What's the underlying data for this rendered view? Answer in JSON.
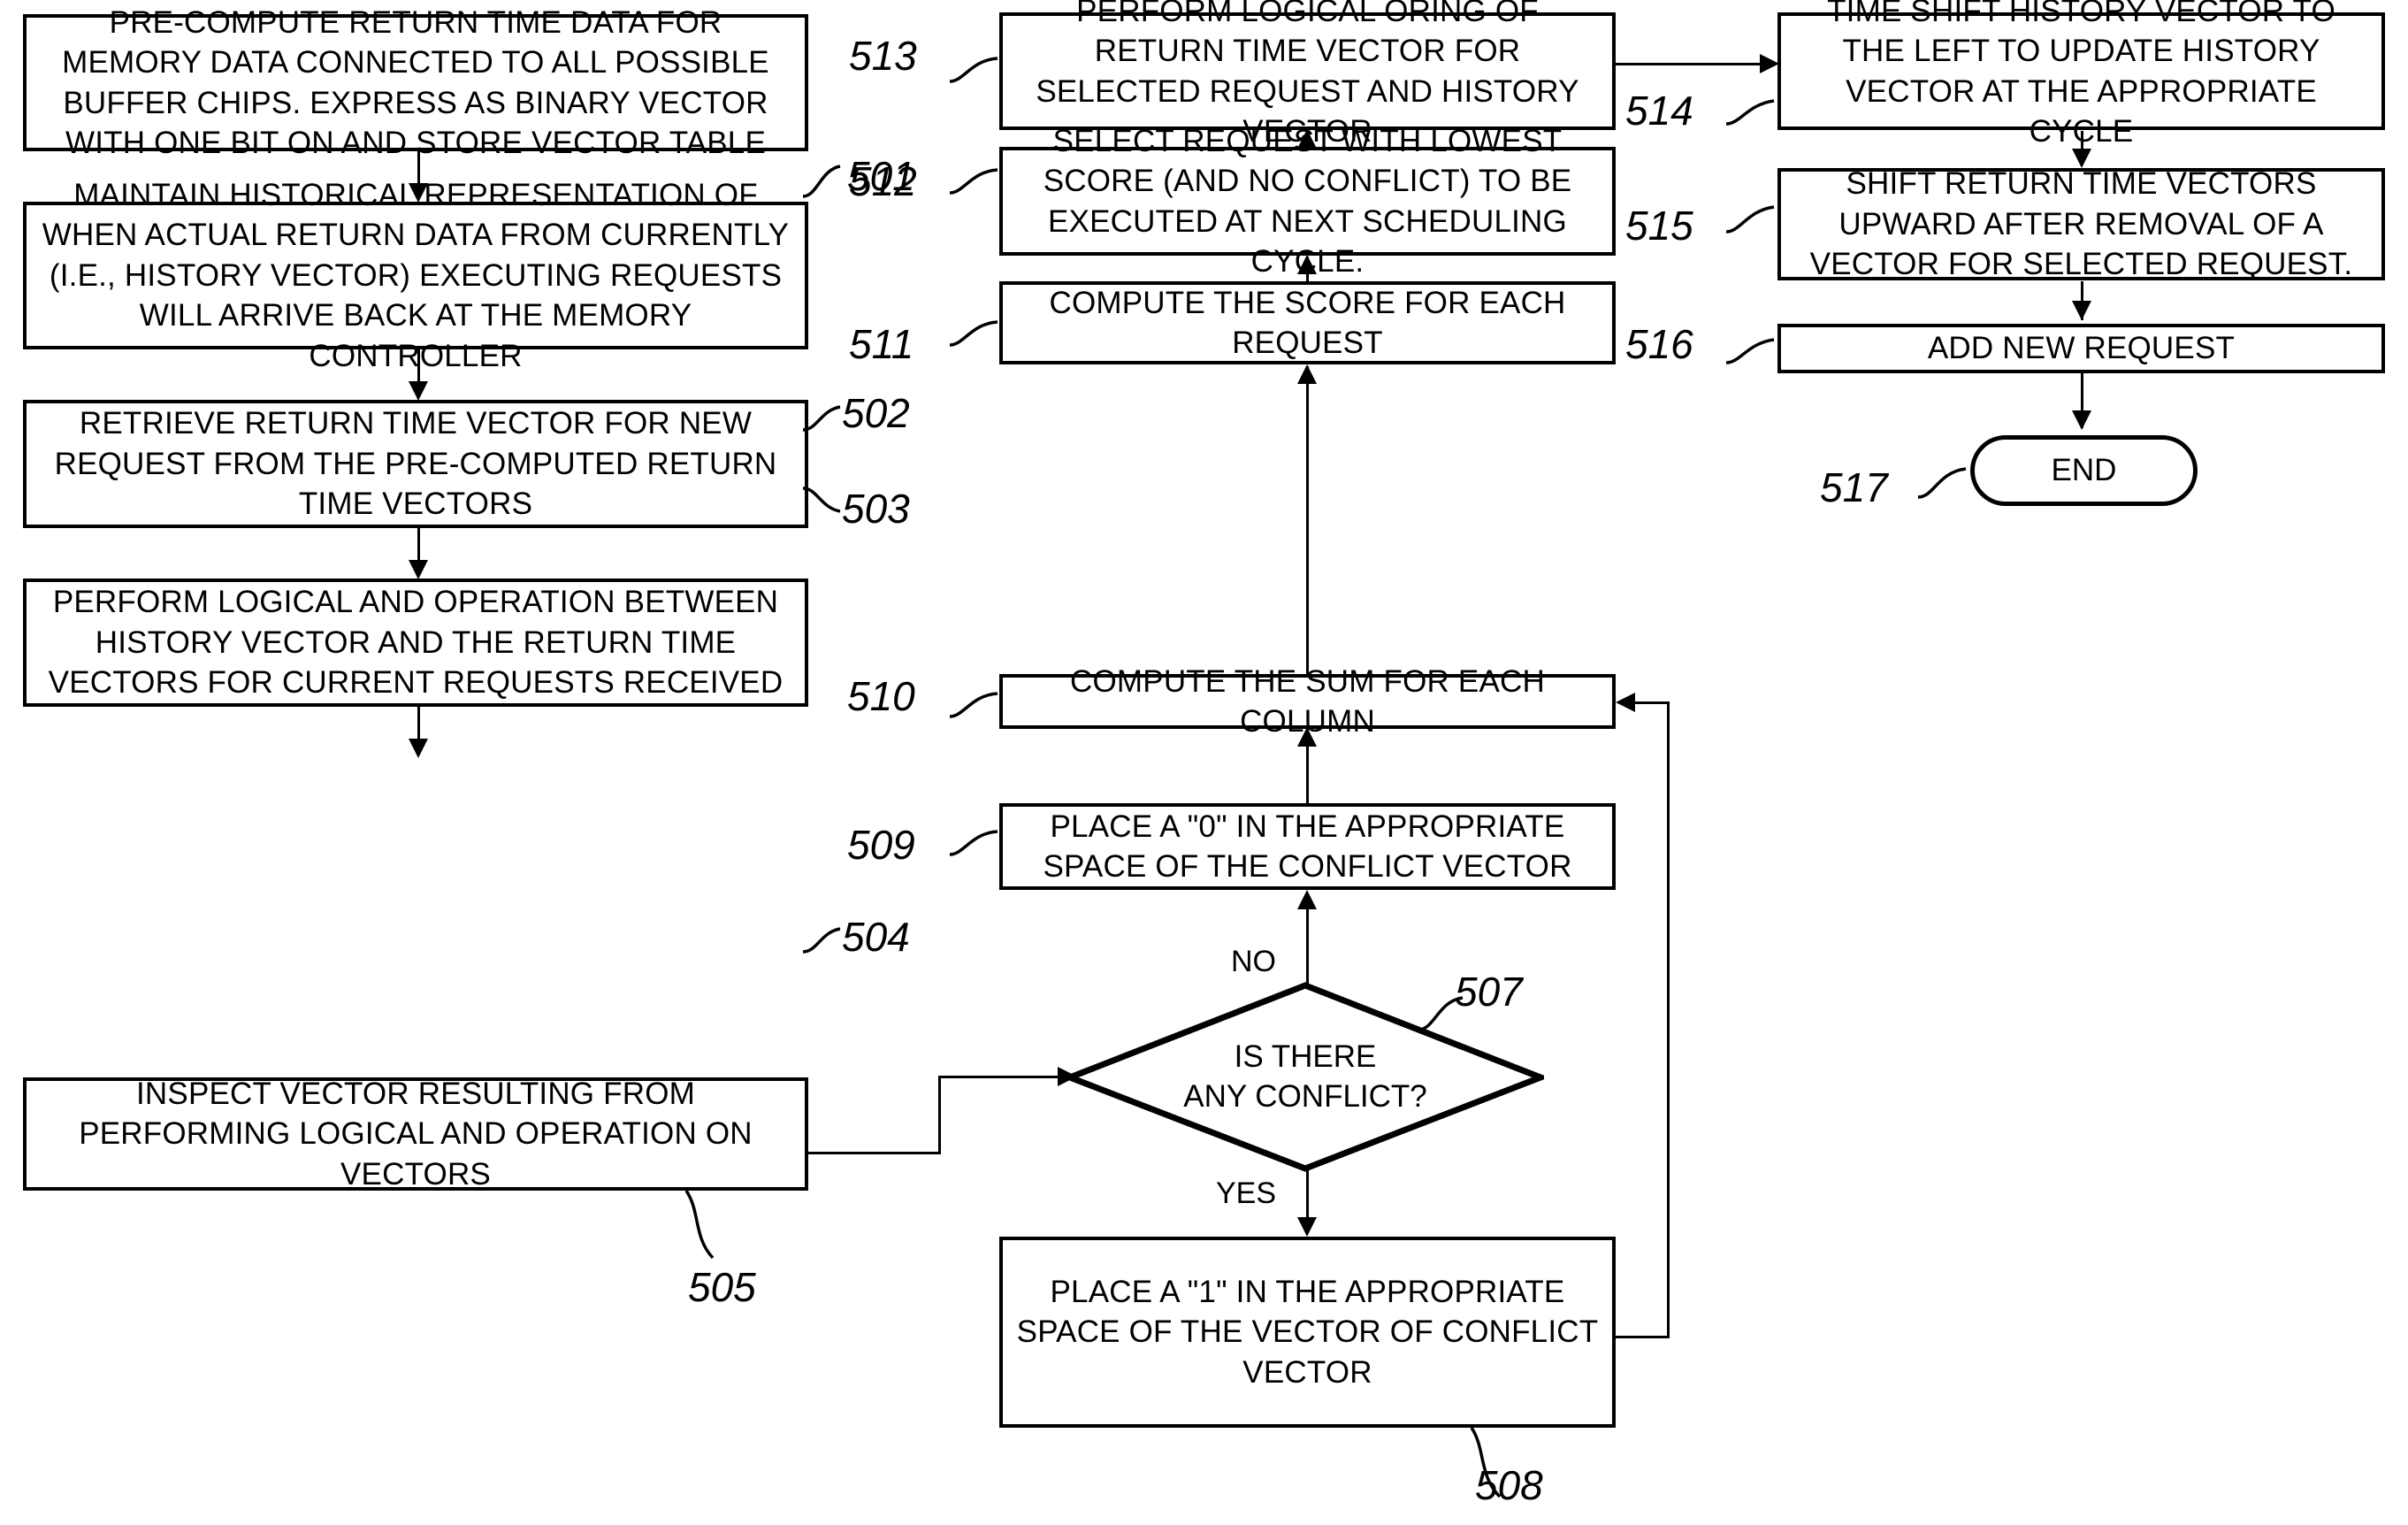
{
  "figure": {
    "kind": "patent-flowchart",
    "background": "#ffffff",
    "ink": "#000000"
  },
  "nodes": [
    {
      "ref": "501",
      "shape": "process",
      "text": "PRE-COMPUTE RETURN TIME DATA FOR MEMORY DATA CONNECTED TO ALL POSSIBLE BUFFER CHIPS. EXPRESS AS BINARY VECTOR WITH ONE BIT ON AND STORE VECTOR TABLE"
    },
    {
      "ref": "502",
      "shape": "process",
      "text": "MAINTAIN HISTORICAL REPRESENTATION OF WHEN ACTUAL RETURN DATA FROM CURRENTLY (I.E., HISTORY VECTOR) EXECUTING REQUESTS WILL ARRIVE BACK AT THE MEMORY CONTROLLER"
    },
    {
      "ref": "503",
      "shape": "process",
      "text": "RETRIEVE RETURN TIME VECTOR FOR NEW REQUEST FROM THE PRE-COMPUTED RETURN TIME VECTORS"
    },
    {
      "ref": "504",
      "shape": "process",
      "text": "PERFORM LOGICAL AND OPERATION BETWEEN HISTORY VECTOR AND THE RETURN TIME VECTORS FOR CURRENT REQUESTS RECEIVED"
    },
    {
      "ref": "505",
      "shape": "process",
      "text": "INSPECT VECTOR RESULTING FROM PERFORMING LOGICAL AND OPERATION ON VECTORS"
    },
    {
      "ref": "507",
      "shape": "decision",
      "text_line1": "IS THERE",
      "text_line2": "ANY CONFLICT?"
    },
    {
      "ref": "508",
      "shape": "process",
      "text": "PLACE A \"1\" IN THE APPROPRIATE SPACE OF THE VECTOR OF CONFLICT VECTOR"
    },
    {
      "ref": "509",
      "shape": "process",
      "text": "PLACE A \"0\" IN THE APPROPRIATE SPACE OF THE CONFLICT VECTOR"
    },
    {
      "ref": "510",
      "shape": "process",
      "text": "COMPUTE THE SUM FOR EACH COLUMN"
    },
    {
      "ref": "511",
      "shape": "process",
      "text": "COMPUTE THE SCORE FOR EACH REQUEST"
    },
    {
      "ref": "512",
      "shape": "process",
      "text": "SELECT REQUEST WITH LOWEST SCORE (AND NO CONFLICT) TO BE EXECUTED AT NEXT SCHEDULING CYCLE."
    },
    {
      "ref": "513",
      "shape": "process",
      "text": "PERFORM LOGICAL ORING OF RETURN TIME VECTOR FOR SELECTED REQUEST AND HISTORY VECTOR"
    },
    {
      "ref": "514",
      "shape": "process",
      "text": "TIME SHIFT HISTORY VECTOR TO THE LEFT TO UPDATE HISTORY VECTOR AT THE APPROPRIATE CYCLE"
    },
    {
      "ref": "515",
      "shape": "process",
      "text": "SHIFT RETURN TIME VECTORS UPWARD AFTER REMOVAL OF A VECTOR FOR SELECTED REQUEST."
    },
    {
      "ref": "516",
      "shape": "process",
      "text": "ADD NEW REQUEST"
    },
    {
      "ref": "517",
      "shape": "terminal",
      "text": "END"
    }
  ],
  "branch_labels": {
    "no": "NO",
    "yes": "YES"
  },
  "refs": {
    "n501": "501",
    "n502": "502",
    "n503": "503",
    "n504": "504",
    "n505": "505",
    "n507": "507",
    "n508": "508",
    "n509": "509",
    "n510": "510",
    "n511": "511",
    "n512": "512",
    "n513": "513",
    "n514": "514",
    "n515": "515",
    "n516": "516",
    "n517": "517"
  },
  "node_text": {
    "b501": "PRE-COMPUTE RETURN TIME DATA FOR MEMORY DATA CONNECTED TO ALL POSSIBLE BUFFER CHIPS. EXPRESS AS BINARY VECTOR WITH ONE BIT ON AND STORE VECTOR TABLE",
    "b502": "MAINTAIN HISTORICAL REPRESENTATION OF WHEN ACTUAL RETURN DATA FROM CURRENTLY (I.E., HISTORY VECTOR) EXECUTING REQUESTS WILL ARRIVE BACK AT THE MEMORY CONTROLLER",
    "b503": "RETRIEVE RETURN TIME VECTOR FOR NEW REQUEST FROM THE PRE-COMPUTED RETURN TIME VECTORS",
    "b504": "PERFORM LOGICAL AND OPERATION BETWEEN HISTORY VECTOR AND THE RETURN TIME VECTORS FOR CURRENT REQUESTS RECEIVED",
    "b505": "INSPECT VECTOR RESULTING FROM PERFORMING LOGICAL AND OPERATION ON VECTORS",
    "d507_l1": "IS THERE",
    "d507_l2": "ANY CONFLICT?",
    "b508": "PLACE A \"1\" IN THE APPROPRIATE SPACE OF THE VECTOR OF CONFLICT VECTOR",
    "b509": "PLACE A \"0\" IN THE APPROPRIATE SPACE OF THE CONFLICT VECTOR",
    "b510": "COMPUTE THE SUM FOR EACH COLUMN",
    "b511": "COMPUTE THE SCORE FOR EACH REQUEST",
    "b512": "SELECT REQUEST WITH LOWEST SCORE (AND NO CONFLICT) TO BE EXECUTED AT NEXT SCHEDULING CYCLE.",
    "b513": "PERFORM LOGICAL ORING OF RETURN TIME VECTOR FOR SELECTED REQUEST AND HISTORY VECTOR",
    "b514": "TIME SHIFT HISTORY VECTOR TO THE LEFT TO UPDATE HISTORY VECTOR AT THE APPROPRIATE CYCLE",
    "b515": "SHIFT RETURN TIME VECTORS UPWARD AFTER REMOVAL OF A VECTOR FOR SELECTED REQUEST.",
    "b516": "ADD NEW REQUEST",
    "t517": "END"
  },
  "flow_edges": [
    {
      "from": "501",
      "to": "502",
      "label": ""
    },
    {
      "from": "502",
      "to": "503",
      "label": ""
    },
    {
      "from": "503",
      "to": "504",
      "label": ""
    },
    {
      "from": "504",
      "to": "505",
      "label": ""
    },
    {
      "from": "505",
      "to": "507",
      "label": ""
    },
    {
      "from": "507",
      "to": "509",
      "label": "NO"
    },
    {
      "from": "507",
      "to": "508",
      "label": "YES"
    },
    {
      "from": "508",
      "to": "510",
      "label": ""
    },
    {
      "from": "509",
      "to": "510",
      "label": ""
    },
    {
      "from": "510",
      "to": "511",
      "label": ""
    },
    {
      "from": "511",
      "to": "512",
      "label": ""
    },
    {
      "from": "512",
      "to": "513",
      "label": ""
    },
    {
      "from": "513",
      "to": "514",
      "label": ""
    },
    {
      "from": "514",
      "to": "515",
      "label": ""
    },
    {
      "from": "515",
      "to": "516",
      "label": ""
    },
    {
      "from": "516",
      "to": "517",
      "label": ""
    }
  ]
}
